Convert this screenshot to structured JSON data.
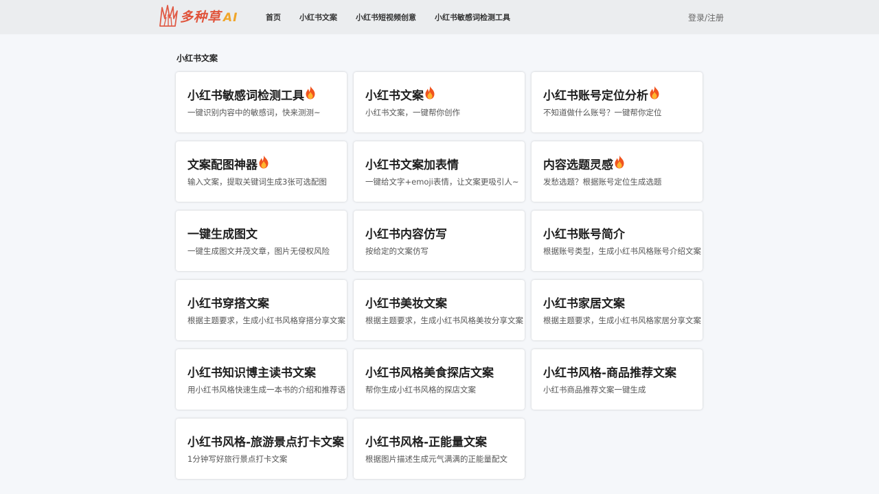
{
  "header": {
    "logo_text": "多种草",
    "logo_ai": "AI",
    "nav": [
      "首页",
      "小红书文案",
      "小红书短视频创意",
      "小红书敏感词检测工具"
    ],
    "login": "登录/注册"
  },
  "section_title": "小红书文案",
  "cards": [
    {
      "title": "小红书敏感词检测工具",
      "desc": "一键识别内容中的敏感词，快来测测~",
      "hot": true
    },
    {
      "title": "小红书文案",
      "desc": "小红书文案，一键帮你创作",
      "hot": true
    },
    {
      "title": "小红书账号定位分析",
      "desc": "不知道做什么账号？一键帮你定位",
      "hot": true
    },
    {
      "title": "文案配图神器",
      "desc": "输入文案，提取关键词生成3张可选配图",
      "hot": true
    },
    {
      "title": "小红书文案加表情",
      "desc": "一键给文字+emoji表情，让文案更吸引人~",
      "hot": false
    },
    {
      "title": "内容选题灵感",
      "desc": "发愁选题？根据账号定位生成选题",
      "hot": true
    },
    {
      "title": "一键生成图文",
      "desc": "一键生成图文并茂文章，图片无侵权风险",
      "hot": false
    },
    {
      "title": "小红书内容仿写",
      "desc": "按给定的文案仿写",
      "hot": false
    },
    {
      "title": "小红书账号简介",
      "desc": "根据账号类型，生成小红书风格账号介绍文案",
      "hot": false
    },
    {
      "title": "小红书穿搭文案",
      "desc": "根据主题要求，生成小红书风格穿搭分享文案",
      "hot": false
    },
    {
      "title": "小红书美妆文案",
      "desc": "根据主题要求，生成小红书风格美妆分享文案",
      "hot": false
    },
    {
      "title": "小红书家居文案",
      "desc": "根据主题要求，生成小红书风格家居分享文案",
      "hot": false
    },
    {
      "title": "小红书知识博主读书文案",
      "desc": "用小红书风格快速生成一本书的介绍和推荐语",
      "hot": false
    },
    {
      "title": "小红书风格美食探店文案",
      "desc": "帮你生成小红书风格的探店文案",
      "hot": false
    },
    {
      "title": "小红书风格-商品推荐文案",
      "desc": "小红书商品推荐文案一键生成",
      "hot": false
    },
    {
      "title": "小红书风格-旅游景点打卡文案",
      "desc": "1分钟写好旅行景点打卡文案",
      "hot": false
    },
    {
      "title": "小红书风格-正能量文案",
      "desc": "根据图片描述生成元气满满的正能量配文",
      "hot": false
    }
  ]
}
